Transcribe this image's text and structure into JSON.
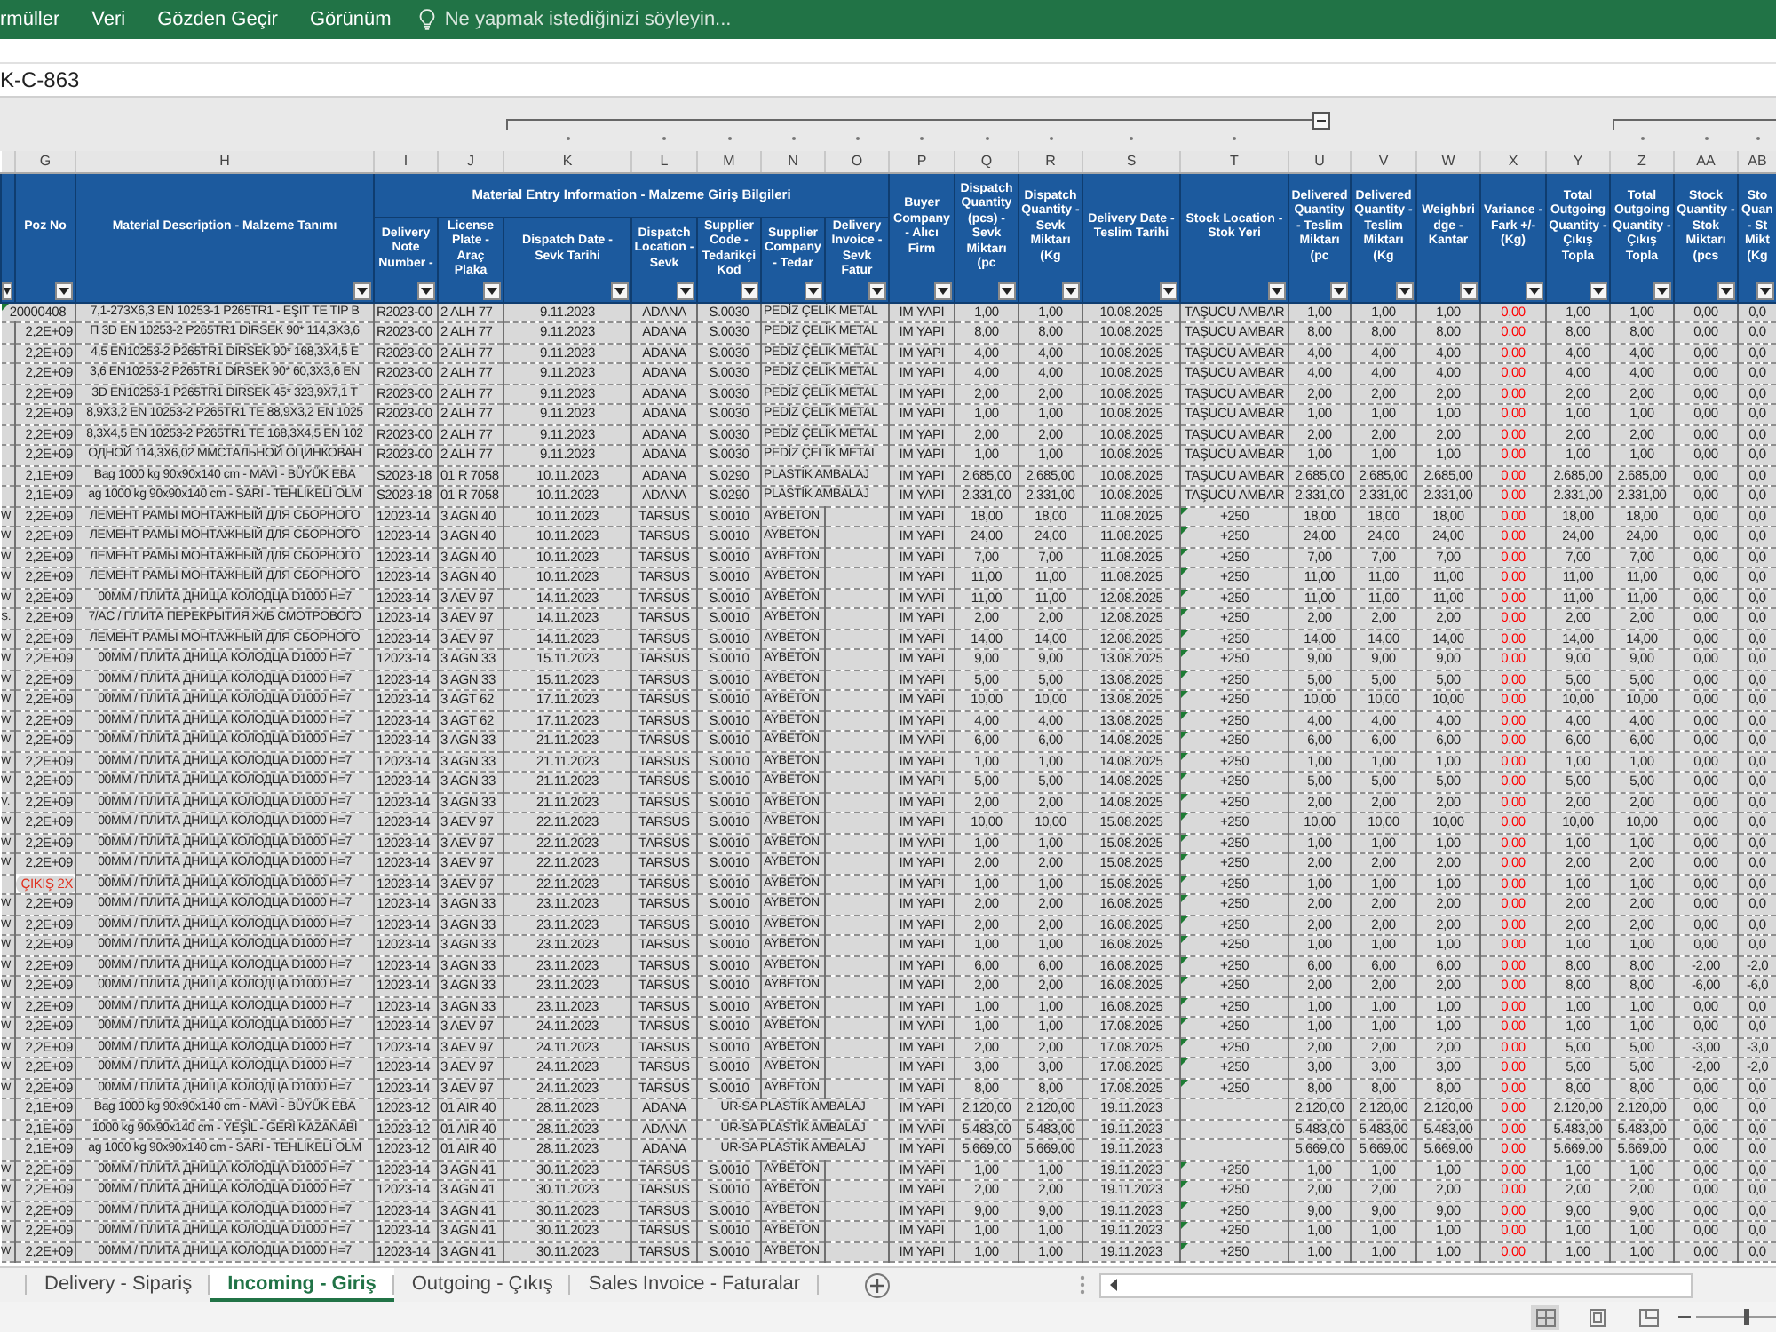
{
  "ribbon": {
    "tabs": [
      {
        "label": "rmüller",
        "selected": false
      },
      {
        "label": "Veri",
        "selected": false
      },
      {
        "label": "Gözden Geçir",
        "selected": false
      },
      {
        "label": "Görünüm",
        "selected": false
      }
    ],
    "tell_me": {
      "placeholder": "Ne yapmak istediğinizi söyleyin..."
    }
  },
  "formula_bar": {
    "value": "K-C-863"
  },
  "outline_buttons": [
    {
      "expanded": true
    }
  ],
  "columns": [
    {
      "grouped": false
    },
    {
      "letter": "G",
      "header": "Poz No",
      "grouped": false
    },
    {
      "letter": "H",
      "header": "Material Description - Malzeme Tanımı",
      "grouped": false
    },
    {
      "title": "Material Entry Information - Malzeme Giriş Bilgileri",
      "columns": [
        {
          "letter": "I",
          "header": "Delivery Note Number -",
          "grouped": false
        },
        {
          "letter": "J",
          "header": "License Plate - Araç Plaka",
          "grouped": false
        },
        {
          "letter": "K",
          "header": "Dispatch Date - Sevk Tarihi",
          "grouped": true
        },
        {
          "letter": "L",
          "header": "Dispatch Location - Sevk",
          "grouped": true
        },
        {
          "letter": "M",
          "header": "Supplier Code - Tedarikçi Kod",
          "grouped": true
        },
        {
          "letter": "N",
          "header": "Supplier Company - Tedar",
          "grouped": true
        },
        {
          "letter": "O",
          "header": "Delivery Invoice - Sevk Fatur",
          "grouped": true
        }
      ]
    },
    {
      "letter": "P",
      "header": "Buyer Company - Alıcı Firm",
      "grouped": true
    },
    {
      "letter": "Q",
      "header": "Dispatch Quantity (pcs) - Sevk Miktarı (pc",
      "grouped": true
    },
    {
      "letter": "R",
      "header": "Dispatch Quantity - Sevk Miktarı (Kg",
      "grouped": true
    },
    {
      "letter": "S",
      "header": "Delivery Date - Teslim Tarihi",
      "grouped": true
    },
    {
      "letter": "T",
      "header": "Stock Location - Stok Yeri",
      "grouped": true
    },
    {
      "letter": "U",
      "header": "Delivered Quantity - Teslim Miktarı (pc",
      "grouped": false
    },
    {
      "letter": "V",
      "header": "Delivered Quantity - Teslim Miktarı (Kg",
      "grouped": false
    },
    {
      "letter": "W",
      "header": "Weighbridge - Kantar",
      "grouped": false
    },
    {
      "letter": "X",
      "header": "Variance - Fark +/- (Kg)",
      "grouped": false
    },
    {
      "letter": "Y",
      "header": "Total Outgoing Quantity - Çıkış Topla",
      "grouped": false
    },
    {
      "letter": "Z",
      "header": "Total Outgoing Quantity - Çıkış Topla",
      "grouped": true
    },
    {
      "letter": "AA",
      "header": "Stock Quantity - Stok Miktarı (pcs",
      "grouped": true
    },
    {
      "letter": "AB",
      "header": "Sto Quan - St Mikt (Kg",
      "grouped": true
    }
  ],
  "rows": [
    {
      "cells": [
        null,
        "20000408",
        "7,1-273X6,3 EN 10253-1 P265TR1 - EŞIT TE TIP B",
        "R2023-00",
        "2 ALH 77",
        "9.11.2023",
        "ADANA",
        "S.0030",
        "PEDİZ ÇELİK METAL",
        null,
        "IM YAPI",
        "1,00",
        "1,00",
        "10.08.2025",
        "TAŞUCU AMBAR",
        "1,00",
        "1,00",
        "1,00",
        "0,00",
        "1,00",
        "1,00",
        "0,00",
        "0,0"
      ],
      "poz_error": true,
      "poz_alert": false,
      "stock_error": false
    },
    {
      "cells": [
        null,
        "2,2E+09",
        "П 3D EN 10253-2 P265TR1 DİRSEK 90* 114,3X3,6",
        "R2023-00",
        "2 ALH 77",
        "9.11.2023",
        "ADANA",
        "S.0030",
        "PEDİZ ÇELİK METAL",
        null,
        "IM YAPI",
        "8,00",
        "8,00",
        "10.08.2025",
        "TAŞUCU AMBAR",
        "8,00",
        "8,00",
        "8,00",
        "0,00",
        "8,00",
        "8,00",
        "0,00",
        "0,0"
      ],
      "poz_error": false,
      "poz_alert": false,
      "stock_error": false
    },
    {
      "cells": [
        null,
        "2,2E+09",
        "4,5 EN10253-2 P265TR1 DİRSEK 90* 168,3X4,5 E",
        "R2023-00",
        "2 ALH 77",
        "9.11.2023",
        "ADANA",
        "S.0030",
        "PEDİZ ÇELİK METAL",
        null,
        "IM YAPI",
        "4,00",
        "4,00",
        "10.08.2025",
        "TAŞUCU AMBAR",
        "4,00",
        "4,00",
        "4,00",
        "0,00",
        "4,00",
        "4,00",
        "0,00",
        "0,0"
      ],
      "poz_error": false,
      "poz_alert": false,
      "stock_error": false
    },
    {
      "cells": [
        null,
        "2,2E+09",
        "3,6 EN10253-2 P265TR1 DİRSEK 90* 60,3X3,6 EN",
        "R2023-00",
        "2 ALH 77",
        "9.11.2023",
        "ADANA",
        "S.0030",
        "PEDİZ ÇELİK METAL",
        null,
        "IM YAPI",
        "4,00",
        "4,00",
        "10.08.2025",
        "TAŞUCU AMBAR",
        "4,00",
        "4,00",
        "4,00",
        "0,00",
        "4,00",
        "4,00",
        "0,00",
        "0,0"
      ],
      "poz_error": false,
      "poz_alert": false,
      "stock_error": false
    },
    {
      "cells": [
        null,
        "2,2E+09",
        "3D EN10253-1 P265TR1 DIRSEK 45* 323,9X7,1 T",
        "R2023-00",
        "2 ALH 77",
        "9.11.2023",
        "ADANA",
        "S.0030",
        "PEDİZ ÇELİK METAL",
        null,
        "IM YAPI",
        "2,00",
        "2,00",
        "10.08.2025",
        "TAŞUCU AMBAR",
        "2,00",
        "2,00",
        "2,00",
        "0,00",
        "2,00",
        "2,00",
        "0,00",
        "0,0"
      ],
      "poz_error": false,
      "poz_alert": false,
      "stock_error": false
    },
    {
      "cells": [
        null,
        "2,2E+09",
        "8,9X3,2 EN 10253-2 P265TR1 TE 88,9X3,2 EN 1025",
        "R2023-00",
        "2 ALH 77",
        "9.11.2023",
        "ADANA",
        "S.0030",
        "PEDİZ ÇELİK METAL",
        null,
        "IM YAPI",
        "1,00",
        "1,00",
        "10.08.2025",
        "TAŞUCU AMBAR",
        "1,00",
        "1,00",
        "1,00",
        "0,00",
        "1,00",
        "1,00",
        "0,00",
        "0,0"
      ],
      "poz_error": false,
      "poz_alert": false,
      "stock_error": false
    },
    {
      "cells": [
        null,
        "2,2E+09",
        "8,3X4,5 EN 10253-2 P265TR1 TE 168,3X4,5 EN 102",
        "R2023-00",
        "2 ALH 77",
        "9.11.2023",
        "ADANA",
        "S.0030",
        "PEDİZ ÇELİK METAL",
        null,
        "IM YAPI",
        "2,00",
        "2,00",
        "10.08.2025",
        "TAŞUCU AMBAR",
        "2,00",
        "2,00",
        "2,00",
        "0,00",
        "2,00",
        "2,00",
        "0,00",
        "0,0"
      ],
      "poz_error": false,
      "poz_alert": false,
      "stock_error": false
    },
    {
      "cells": [
        null,
        "2,2E+09",
        "ОДНОЙ 114,3X6,02 ММСТАЛЬНОЙ ОЦИНКОВАН",
        "R2023-00",
        "2 ALH 77",
        "9.11.2023",
        "ADANA",
        "S.0030",
        "PEDİZ ÇELİK METAL",
        null,
        "IM YAPI",
        "1,00",
        "1,00",
        "10.08.2025",
        "TAŞUCU AMBAR",
        "1,00",
        "1,00",
        "1,00",
        "0,00",
        "1,00",
        "1,00",
        "0,00",
        "0,0"
      ],
      "poz_error": false,
      "poz_alert": false,
      "stock_error": false
    },
    {
      "cells": [
        null,
        "2,1E+09",
        "Bag 1000 kg 90x90x140 cm - MAVİ - BÜYÜK EBA",
        "S2023-18",
        "01 R 7058",
        "10.11.2023",
        "ADANA",
        "S.0290",
        "PLASTİK AMBALAJ",
        null,
        "IM YAPI",
        "2.685,00",
        "2.685,00",
        "10.08.2025",
        "TAŞUCU AMBAR",
        "2.685,00",
        "2.685,00",
        "2.685,00",
        "0,00",
        "2.685,00",
        "2.685,00",
        "0,00",
        "0,0"
      ],
      "poz_error": false,
      "poz_alert": false,
      "stock_error": false
    },
    {
      "cells": [
        null,
        "2,1E+09",
        "ag 1000 kg 90x90x140 cm - SARI - TEHLİKELİ OLM",
        "S2023-18",
        "01 R 7058",
        "10.11.2023",
        "ADANA",
        "S.0290",
        "PLASTİK AMBALAJ",
        null,
        "IM YAPI",
        "2.331,00",
        "2.331,00",
        "10.08.2025",
        "TAŞUCU AMBAR",
        "2.331,00",
        "2.331,00",
        "2.331,00",
        "0,00",
        "2.331,00",
        "2.331,00",
        "0,00",
        "0,0"
      ],
      "poz_error": false,
      "poz_alert": false,
      "stock_error": false
    },
    {
      "cells": [
        "W",
        "2,2E+09",
        "ЛЕМЕНТ РАМЫ МОНТАЖНЫЙ ДЛЯ СБОРНОГО",
        "12023-14",
        "3 AGN 40",
        "10.11.2023",
        "TARSUS",
        "S.0010",
        "AYBETON",
        null,
        "IM YAPI",
        "18,00",
        "18,00",
        "11.08.2025",
        "+250",
        "18,00",
        "18,00",
        "18,00",
        "0,00",
        "18,00",
        "18,00",
        "0,00",
        "0,0"
      ],
      "poz_error": false,
      "poz_alert": false,
      "stock_error": true
    },
    {
      "cells": [
        "W",
        "2,2E+09",
        "ЛЕМЕНТ РАМЫ МОНТАЖНЫЙ ДЛЯ СБОРНОГО",
        "12023-14",
        "3 AGN 40",
        "10.11.2023",
        "TARSUS",
        "S.0010",
        "AYBETON",
        null,
        "IM YAPI",
        "24,00",
        "24,00",
        "11.08.2025",
        "+250",
        "24,00",
        "24,00",
        "24,00",
        "0,00",
        "24,00",
        "24,00",
        "0,00",
        "0,0"
      ],
      "poz_error": false,
      "poz_alert": false,
      "stock_error": true
    },
    {
      "cells": [
        "W",
        "2,2E+09",
        "ЛЕМЕНТ РАМЫ МОНТАЖНЫЙ ДЛЯ СБОРНОГО",
        "12023-14",
        "3 AGN 40",
        "10.11.2023",
        "TARSUS",
        "S.0010",
        "AYBETON",
        null,
        "IM YAPI",
        "7,00",
        "7,00",
        "11.08.2025",
        "+250",
        "7,00",
        "7,00",
        "7,00",
        "0,00",
        "7,00",
        "7,00",
        "0,00",
        "0,0"
      ],
      "poz_error": false,
      "poz_alert": false,
      "stock_error": true
    },
    {
      "cells": [
        "W",
        "2,2E+09",
        "ЛЕМЕНТ РАМЫ МОНТАЖНЫЙ ДЛЯ СБОРНОГО",
        "12023-14",
        "3 AGN 40",
        "10.11.2023",
        "TARSUS",
        "S.0010",
        "AYBETON",
        null,
        "IM YAPI",
        "11,00",
        "11,00",
        "11.08.2025",
        "+250",
        "11,00",
        "11,00",
        "11,00",
        "0,00",
        "11,00",
        "11,00",
        "0,00",
        "0,0"
      ],
      "poz_error": false,
      "poz_alert": false,
      "stock_error": true
    },
    {
      "cells": [
        "W",
        "2,2E+09",
        "00MM / ПЛИТА ДНИЩА КОЛОДЦА D1000 H=7",
        "12023-14",
        "3 AEV 97",
        "14.11.2023",
        "TARSUS",
        "S.0010",
        "AYBETON",
        null,
        "IM YAPI",
        "11,00",
        "11,00",
        "12.08.2025",
        "+250",
        "11,00",
        "11,00",
        "11,00",
        "0,00",
        "11,00",
        "11,00",
        "0,00",
        "0,0"
      ],
      "poz_error": false,
      "poz_alert": false,
      "stock_error": true
    },
    {
      "cells": [
        "S.",
        "2,2E+09",
        "7/AC / ПЛИТА ПЕРЕКРЫТИЯ Ж/Б СМОТРОВОГО",
        "12023-14",
        "3 AEV 97",
        "14.11.2023",
        "TARSUS",
        "S.0010",
        "AYBETON",
        null,
        "IM YAPI",
        "2,00",
        "2,00",
        "12.08.2025",
        "+250",
        "2,00",
        "2,00",
        "2,00",
        "0,00",
        "2,00",
        "2,00",
        "0,00",
        "0,0"
      ],
      "poz_error": false,
      "poz_alert": false,
      "stock_error": true
    },
    {
      "cells": [
        "W",
        "2,2E+09",
        "ЛЕМЕНТ РАМЫ МОНТАЖНЫЙ ДЛЯ СБОРНОГО",
        "12023-14",
        "3 AEV 97",
        "14.11.2023",
        "TARSUS",
        "S.0010",
        "AYBETON",
        null,
        "IM YAPI",
        "14,00",
        "14,00",
        "12.08.2025",
        "+250",
        "14,00",
        "14,00",
        "14,00",
        "0,00",
        "14,00",
        "14,00",
        "0,00",
        "0,0"
      ],
      "poz_error": false,
      "poz_alert": false,
      "stock_error": true
    },
    {
      "cells": [
        "W",
        "2,2E+09",
        "00MM / ПЛИТА ДНИЩА КОЛОДЦА D1000 H=7",
        "12023-14",
        "3 AGN 33",
        "15.11.2023",
        "TARSUS",
        "S.0010",
        "AYBETON",
        null,
        "IM YAPI",
        "9,00",
        "9,00",
        "13.08.2025",
        "+250",
        "9,00",
        "9,00",
        "9,00",
        "0,00",
        "9,00",
        "9,00",
        "0,00",
        "0,0"
      ],
      "poz_error": false,
      "poz_alert": false,
      "stock_error": true
    },
    {
      "cells": [
        "W",
        "2,2E+09",
        "00MM / ПЛИТА ДНИЩА КОЛОДЦА D1000 H=7",
        "12023-14",
        "3 AGN 33",
        "15.11.2023",
        "TARSUS",
        "S.0010",
        "AYBETON",
        null,
        "IM YAPI",
        "5,00",
        "5,00",
        "13.08.2025",
        "+250",
        "5,00",
        "5,00",
        "5,00",
        "0,00",
        "5,00",
        "5,00",
        "0,00",
        "0,0"
      ],
      "poz_error": false,
      "poz_alert": false,
      "stock_error": true
    },
    {
      "cells": [
        "W",
        "2,2E+09",
        "00MM / ПЛИТА ДНИЩА КОЛОДЦА D1000 H=7",
        "12023-14",
        "3 AGT 62",
        "17.11.2023",
        "TARSUS",
        "S.0010",
        "AYBETON",
        null,
        "IM YAPI",
        "10,00",
        "10,00",
        "13.08.2025",
        "+250",
        "10,00",
        "10,00",
        "10,00",
        "0,00",
        "10,00",
        "10,00",
        "0,00",
        "0,0"
      ],
      "poz_error": false,
      "poz_alert": false,
      "stock_error": true
    },
    {
      "cells": [
        "W",
        "2,2E+09",
        "00MM / ПЛИТА ДНИЩА КОЛОДЦА D1000 H=7",
        "12023-14",
        "3 AGT 62",
        "17.11.2023",
        "TARSUS",
        "S.0010",
        "AYBETON",
        null,
        "IM YAPI",
        "4,00",
        "4,00",
        "13.08.2025",
        "+250",
        "4,00",
        "4,00",
        "4,00",
        "0,00",
        "4,00",
        "4,00",
        "0,00",
        "0,0"
      ],
      "poz_error": false,
      "poz_alert": false,
      "stock_error": true
    },
    {
      "cells": [
        "W",
        "2,2E+09",
        "00MM / ПЛИТА ДНИЩА КОЛОДЦА D1000 H=7",
        "12023-14",
        "3 AGN 33",
        "21.11.2023",
        "TARSUS",
        "S.0010",
        "AYBETON",
        null,
        "IM YAPI",
        "6,00",
        "6,00",
        "14.08.2025",
        "+250",
        "6,00",
        "6,00",
        "6,00",
        "0,00",
        "6,00",
        "6,00",
        "0,00",
        "0,0"
      ],
      "poz_error": false,
      "poz_alert": false,
      "stock_error": true
    },
    {
      "cells": [
        "W",
        "2,2E+09",
        "00MM / ПЛИТА ДНИЩА КОЛОДЦА D1000 H=7",
        "12023-14",
        "3 AGN 33",
        "21.11.2023",
        "TARSUS",
        "S.0010",
        "AYBETON",
        null,
        "IM YAPI",
        "1,00",
        "1,00",
        "14.08.2025",
        "+250",
        "1,00",
        "1,00",
        "1,00",
        "0,00",
        "1,00",
        "1,00",
        "0,00",
        "0,0"
      ],
      "poz_error": false,
      "poz_alert": false,
      "stock_error": true
    },
    {
      "cells": [
        "W",
        "2,2E+09",
        "00MM / ПЛИТА ДНИЩА КОЛОДЦА D1000 H=7",
        "12023-14",
        "3 AGN 33",
        "21.11.2023",
        "TARSUS",
        "S.0010",
        "AYBETON",
        null,
        "IM YAPI",
        "5,00",
        "5,00",
        "14.08.2025",
        "+250",
        "5,00",
        "5,00",
        "5,00",
        "0,00",
        "5,00",
        "5,00",
        "0,00",
        "0,0"
      ],
      "poz_error": false,
      "poz_alert": false,
      "stock_error": true
    },
    {
      "cells": [
        "V.",
        "2,2E+09",
        "00MM / ПЛИТА ДНИЩА КОЛОДЦА D1000 H=7",
        "12023-14",
        "3 AGN 33",
        "21.11.2023",
        "TARSUS",
        "S.0010",
        "AYBETON",
        null,
        "IM YAPI",
        "2,00",
        "2,00",
        "14.08.2025",
        "+250",
        "2,00",
        "2,00",
        "2,00",
        "0,00",
        "2,00",
        "2,00",
        "0,00",
        "0,0"
      ],
      "poz_error": false,
      "poz_alert": false,
      "stock_error": true
    },
    {
      "cells": [
        "W",
        "2,2E+09",
        "00MM / ПЛИТА ДНИЩА КОЛОДЦА D1000 H=7",
        "12023-14",
        "3 AEV 97",
        "22.11.2023",
        "TARSUS",
        "S.0010",
        "AYBETON",
        null,
        "IM YAPI",
        "10,00",
        "10,00",
        "15.08.2025",
        "+250",
        "10,00",
        "10,00",
        "10,00",
        "0,00",
        "10,00",
        "10,00",
        "0,00",
        "0,0"
      ],
      "poz_error": false,
      "poz_alert": false,
      "stock_error": true
    },
    {
      "cells": [
        "W",
        "2,2E+09",
        "00MM / ПЛИТА ДНИЩА КОЛОДЦА D1000 H=7",
        "12023-14",
        "3 AEV 97",
        "22.11.2023",
        "TARSUS",
        "S.0010",
        "AYBETON",
        null,
        "IM YAPI",
        "1,00",
        "1,00",
        "15.08.2025",
        "+250",
        "1,00",
        "1,00",
        "1,00",
        "0,00",
        "1,00",
        "1,00",
        "0,00",
        "0,0"
      ],
      "poz_error": false,
      "poz_alert": false,
      "stock_error": true
    },
    {
      "cells": [
        "W",
        "2,2E+09",
        "00MM / ПЛИТА ДНИЩА КОЛОДЦА D1000 H=7",
        "12023-14",
        "3 AEV 97",
        "22.11.2023",
        "TARSUS",
        "S.0010",
        "AYBETON",
        null,
        "IM YAPI",
        "2,00",
        "2,00",
        "15.08.2025",
        "+250",
        "2,00",
        "2,00",
        "2,00",
        "0,00",
        "2,00",
        "2,00",
        "0,00",
        "0,0"
      ],
      "poz_error": false,
      "poz_alert": false,
      "stock_error": true
    },
    {
      "cells": [
        null,
        "ÇIKIŞ 2X",
        "00MM / ПЛИТА ДНИЩА КОЛОДЦА D1000 H=7",
        "12023-14",
        "3 AEV 97",
        "22.11.2023",
        "TARSUS",
        "S.0010",
        "AYBETON",
        null,
        "IM YAPI",
        "1,00",
        "1,00",
        "15.08.2025",
        "+250",
        "1,00",
        "1,00",
        "1,00",
        "0,00",
        "1,00",
        "1,00",
        "0,00",
        "0,0"
      ],
      "poz_error": false,
      "poz_alert": true,
      "stock_error": true
    },
    {
      "cells": [
        "W",
        "2,2E+09",
        "00MM / ПЛИТА ДНИЩА КОЛОДЦА D1000 H=7",
        "12023-14",
        "3 AGN 33",
        "23.11.2023",
        "TARSUS",
        "S.0010",
        "AYBETON",
        null,
        "IM YAPI",
        "2,00",
        "2,00",
        "16.08.2025",
        "+250",
        "2,00",
        "2,00",
        "2,00",
        "0,00",
        "2,00",
        "2,00",
        "0,00",
        "0,0"
      ],
      "poz_error": false,
      "poz_alert": false,
      "stock_error": true
    },
    {
      "cells": [
        "W",
        "2,2E+09",
        "00MM / ПЛИТА ДНИЩА КОЛОДЦА D1000 H=7",
        "12023-14",
        "3 AGN 33",
        "23.11.2023",
        "TARSUS",
        "S.0010",
        "AYBETON",
        null,
        "IM YAPI",
        "2,00",
        "2,00",
        "16.08.2025",
        "+250",
        "2,00",
        "2,00",
        "2,00",
        "0,00",
        "2,00",
        "2,00",
        "0,00",
        "0,0"
      ],
      "poz_error": false,
      "poz_alert": false,
      "stock_error": true
    },
    {
      "cells": [
        "W",
        "2,2E+09",
        "00MM / ПЛИТА ДНИЩА КОЛОДЦА D1000 H=7",
        "12023-14",
        "3 AGN 33",
        "23.11.2023",
        "TARSUS",
        "S.0010",
        "AYBETON",
        null,
        "IM YAPI",
        "1,00",
        "1,00",
        "16.08.2025",
        "+250",
        "1,00",
        "1,00",
        "1,00",
        "0,00",
        "1,00",
        "1,00",
        "0,00",
        "0,0"
      ],
      "poz_error": false,
      "poz_alert": false,
      "stock_error": true
    },
    {
      "cells": [
        "W",
        "2,2E+09",
        "00MM / ПЛИТА ДНИЩА КОЛОДЦА D1000 H=7",
        "12023-14",
        "3 AGN 33",
        "23.11.2023",
        "TARSUS",
        "S.0010",
        "AYBETON",
        null,
        "IM YAPI",
        "6,00",
        "6,00",
        "16.08.2025",
        "+250",
        "6,00",
        "6,00",
        "6,00",
        "0,00",
        "8,00",
        "8,00",
        "-2,00",
        "-2,0"
      ],
      "poz_error": false,
      "poz_alert": false,
      "stock_error": true
    },
    {
      "cells": [
        "W",
        "2,2E+09",
        "00MM / ПЛИТА ДНИЩА КОЛОДЦА D1000 H=7",
        "12023-14",
        "3 AGN 33",
        "23.11.2023",
        "TARSUS",
        "S.0010",
        "AYBETON",
        null,
        "IM YAPI",
        "2,00",
        "2,00",
        "16.08.2025",
        "+250",
        "2,00",
        "2,00",
        "2,00",
        "0,00",
        "8,00",
        "8,00",
        "-6,00",
        "-6,0"
      ],
      "poz_error": false,
      "poz_alert": false,
      "stock_error": true
    },
    {
      "cells": [
        "W",
        "2,2E+09",
        "00MM / ПЛИТА ДНИЩА КОЛОДЦА D1000 H=7",
        "12023-14",
        "3 AGN 33",
        "23.11.2023",
        "TARSUS",
        "S.0010",
        "AYBETON",
        null,
        "IM YAPI",
        "1,00",
        "1,00",
        "16.08.2025",
        "+250",
        "1,00",
        "1,00",
        "1,00",
        "0,00",
        "1,00",
        "1,00",
        "0,00",
        "0,0"
      ],
      "poz_error": false,
      "poz_alert": false,
      "stock_error": true
    },
    {
      "cells": [
        "W",
        "2,2E+09",
        "00MM / ПЛИТА ДНИЩА КОЛОДЦА D1000 H=7",
        "12023-14",
        "3 AEV 97",
        "24.11.2023",
        "TARSUS",
        "S.0010",
        "AYBETON",
        null,
        "IM YAPI",
        "1,00",
        "1,00",
        "17.08.2025",
        "+250",
        "1,00",
        "1,00",
        "1,00",
        "0,00",
        "1,00",
        "1,00",
        "0,00",
        "0,0"
      ],
      "poz_error": false,
      "poz_alert": false,
      "stock_error": true
    },
    {
      "cells": [
        "W",
        "2,2E+09",
        "00MM / ПЛИТА ДНИЩА КОЛОДЦА D1000 H=7",
        "12023-14",
        "3 AEV 97",
        "24.11.2023",
        "TARSUS",
        "S.0010",
        "AYBETON",
        null,
        "IM YAPI",
        "2,00",
        "2,00",
        "17.08.2025",
        "+250",
        "2,00",
        "2,00",
        "2,00",
        "0,00",
        "5,00",
        "5,00",
        "-3,00",
        "-3,0"
      ],
      "poz_error": false,
      "poz_alert": false,
      "stock_error": true
    },
    {
      "cells": [
        "W",
        "2,2E+09",
        "00MM / ПЛИТА ДНИЩА КОЛОДЦА D1000 H=7",
        "12023-14",
        "3 AEV 97",
        "24.11.2023",
        "TARSUS",
        "S.0010",
        "AYBETON",
        null,
        "IM YAPI",
        "3,00",
        "3,00",
        "17.08.2025",
        "+250",
        "3,00",
        "3,00",
        "3,00",
        "0,00",
        "5,00",
        "5,00",
        "-2,00",
        "-2,0"
      ],
      "poz_error": false,
      "poz_alert": false,
      "stock_error": true
    },
    {
      "cells": [
        "W",
        "2,2E+09",
        "00MM / ПЛИТА ДНИЩА КОЛОДЦА D1000 H=7",
        "12023-14",
        "3 AEV 97",
        "24.11.2023",
        "TARSUS",
        "S.0010",
        "AYBETON",
        null,
        "IM YAPI",
        "8,00",
        "8,00",
        "17.08.2025",
        "+250",
        "8,00",
        "8,00",
        "8,00",
        "0,00",
        "8,00",
        "8,00",
        "0,00",
        "0,0"
      ],
      "poz_error": false,
      "poz_alert": false,
      "stock_error": true
    },
    {
      "cells": [
        null,
        "2,1E+09",
        "Bag 1000 kg 90x90x140 cm - MAVİ - BÜYÜK EBA",
        "12023-12",
        "01 AIR 40",
        "28.11.2023",
        "ADANA",
        null,
        "UR-SA PLASTİK AMBALAJ",
        null,
        "IM YAPI",
        "2.120,00",
        "2.120,00",
        "19.11.2023",
        null,
        "2.120,00",
        "2.120,00",
        "2.120,00",
        "0,00",
        "2.120,00",
        "2.120,00",
        "0,00",
        "0,0"
      ],
      "poz_error": false,
      "poz_alert": false,
      "stock_error": false
    },
    {
      "cells": [
        null,
        "2,1E+09",
        "1000 kg 90x90x140 cm - YEŞİL - GERİ KAZANABİ",
        "12023-12",
        "01 AIR 40",
        "28.11.2023",
        "ADANA",
        null,
        "UR-SA PLASTİK AMBALAJ",
        null,
        "IM YAPI",
        "5.483,00",
        "5.483,00",
        "19.11.2023",
        null,
        "5.483,00",
        "5.483,00",
        "5.483,00",
        "0,00",
        "5.483,00",
        "5.483,00",
        "0,00",
        "0,0"
      ],
      "poz_error": false,
      "poz_alert": false,
      "stock_error": false
    },
    {
      "cells": [
        null,
        "2,1E+09",
        "ag 1000 kg 90x90x140 cm - SARI - TEHLİKELİ OLM",
        "12023-12",
        "01 AIR 40",
        "28.11.2023",
        "ADANA",
        null,
        "UR-SA PLASTİK AMBALAJ",
        null,
        "IM YAPI",
        "5.669,00",
        "5.669,00",
        "19.11.2023",
        null,
        "5.669,00",
        "5.669,00",
        "5.669,00",
        "0,00",
        "5.669,00",
        "5.669,00",
        "0,00",
        "0,0"
      ],
      "poz_error": false,
      "poz_alert": false,
      "stock_error": false
    },
    {
      "cells": [
        "W",
        "2,2E+09",
        "00MM / ПЛИТА ДНИЩА КОЛОДЦА D1000 H=7",
        "12023-14",
        "3 AGN 41",
        "30.11.2023",
        "TARSUS",
        "S.0010",
        "AYBETON",
        null,
        "IM YAPI",
        "1,00",
        "1,00",
        "19.11.2023",
        "+250",
        "1,00",
        "1,00",
        "1,00",
        "0,00",
        "1,00",
        "1,00",
        "0,00",
        "0,0"
      ],
      "poz_error": false,
      "poz_alert": false,
      "stock_error": true
    },
    {
      "cells": [
        "W",
        "2,2E+09",
        "00MM / ПЛИТА ДНИЩА КОЛОДЦА D1000 H=7",
        "12023-14",
        "3 AGN 41",
        "30.11.2023",
        "TARSUS",
        "S.0010",
        "AYBETON",
        null,
        "IM YAPI",
        "2,00",
        "2,00",
        "19.11.2023",
        "+250",
        "2,00",
        "2,00",
        "2,00",
        "0,00",
        "2,00",
        "2,00",
        "0,00",
        "0,0"
      ],
      "poz_error": false,
      "poz_alert": false,
      "stock_error": true
    },
    {
      "cells": [
        "W",
        "2,2E+09",
        "00MM / ПЛИТА ДНИЩА КОЛОДЦА D1000 H=7",
        "12023-14",
        "3 AGN 41",
        "30.11.2023",
        "TARSUS",
        "S.0010",
        "AYBETON",
        null,
        "IM YAPI",
        "9,00",
        "9,00",
        "19.11.2023",
        "+250",
        "9,00",
        "9,00",
        "9,00",
        "0,00",
        "9,00",
        "9,00",
        "0,00",
        "0,0"
      ],
      "poz_error": false,
      "poz_alert": false,
      "stock_error": true
    },
    {
      "cells": [
        "W",
        "2,2E+09",
        "00MM / ПЛИТА ДНИЩА КОЛОДЦА D1000 H=7",
        "12023-14",
        "3 AGN 41",
        "30.11.2023",
        "TARSUS",
        "S.0010",
        "AYBETON",
        null,
        "IM YAPI",
        "1,00",
        "1,00",
        "19.11.2023",
        "+250",
        "1,00",
        "1,00",
        "1,00",
        "0,00",
        "1,00",
        "1,00",
        "0,00",
        "0,0"
      ],
      "poz_error": false,
      "poz_alert": false,
      "stock_error": true
    },
    {
      "cells": [
        "W",
        "2,2E+09",
        "00MM / ПЛИТА ДНИЩА КОЛОДЦА D1000 H=7",
        "12023-14",
        "3 AGN 41",
        "30.11.2023",
        "TARSUS",
        "S.0010",
        "AYBETON",
        null,
        "IM YAPI",
        "1,00",
        "1,00",
        "19.11.2023",
        "+250",
        "1,00",
        "1,00",
        "1,00",
        "0,00",
        "1,00",
        "1,00",
        "0,00",
        "0,0"
      ],
      "poz_error": false,
      "poz_alert": false,
      "stock_error": true
    }
  ],
  "sheet_tabs": [
    {
      "label": "Delivery - Sipariş",
      "selected": false
    },
    {
      "label": "Incoming - Giriş",
      "selected": true
    },
    {
      "label": "Outgoing - Çıkış",
      "selected": false
    },
    {
      "label": "Sales Invoice - Faturalar",
      "selected": false
    }
  ],
  "status_bar": {
    "views": [
      {
        "kind": "normal",
        "selected": true
      },
      {
        "kind": "page_layout",
        "selected": false
      },
      {
        "kind": "page_break",
        "selected": false
      }
    ],
    "zoom": {
      "level": 0.64
    }
  }
}
